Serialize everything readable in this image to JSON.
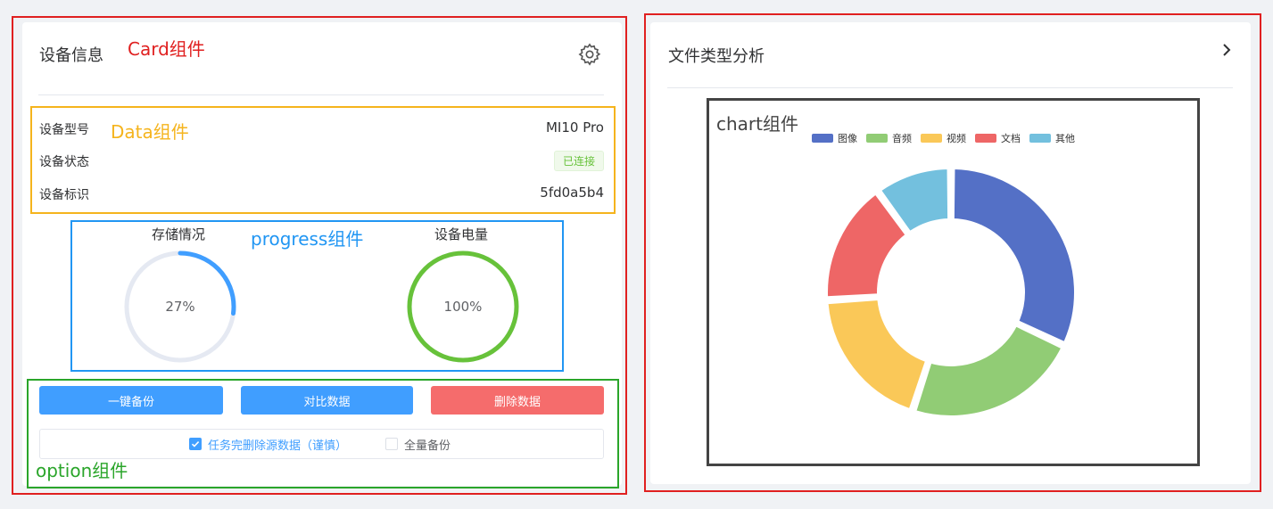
{
  "device_card": {
    "title": "设备信息",
    "card_annotation": "Card组件",
    "data_annotation": "Data组件",
    "progress_annotation": "progress组件",
    "option_annotation": "option组件",
    "rows": [
      {
        "label": "设备型号",
        "value": "MI10 Pro"
      },
      {
        "label": "设备状态",
        "value": "已连接"
      },
      {
        "label": "设备标识",
        "value": "5fd0a5b4"
      }
    ],
    "storage": {
      "label": "存储情况",
      "percent": 27,
      "text": "27%",
      "color": "#409eff"
    },
    "battery": {
      "label": "设备电量",
      "percent": 100,
      "text": "100%",
      "color": "#67c23a"
    },
    "buttons": [
      {
        "label": "一键备份",
        "color": "#409eff"
      },
      {
        "label": "对比数据",
        "color": "#409eff"
      },
      {
        "label": "删除数据",
        "color": "#f56c6c"
      }
    ],
    "options": [
      {
        "label": "任务完删除源数据（谨慎）",
        "checked": true
      },
      {
        "label": "全量备份",
        "checked": false
      }
    ]
  },
  "file_card": {
    "title": "文件类型分析",
    "chart_annotation": "chart组件",
    "chart_data": {
      "type": "pie",
      "categories": [
        "图像",
        "音频",
        "视频",
        "文档",
        "其他"
      ],
      "values": [
        32,
        23,
        19,
        16,
        10
      ],
      "colors": [
        "#5470c6",
        "#91cc75",
        "#fac858",
        "#ee6666",
        "#73c0de"
      ]
    }
  }
}
